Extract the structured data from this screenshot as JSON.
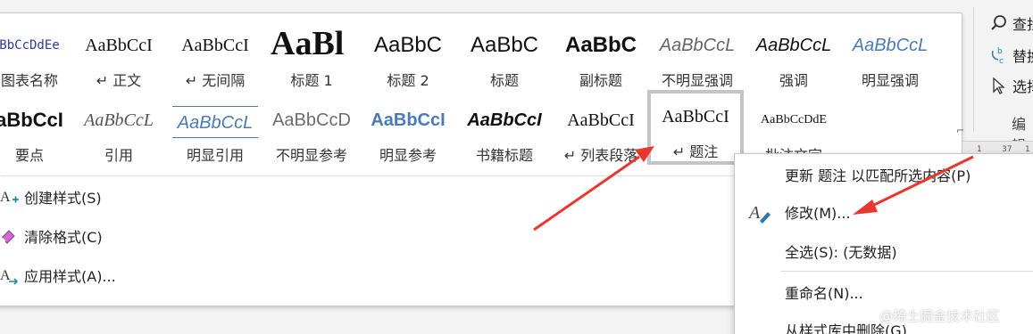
{
  "gallery": {
    "row1": [
      {
        "sample": "BbCcDdEe",
        "label": "图表名称"
      },
      {
        "sample": "AaBbCcI",
        "label": "↵ 正文"
      },
      {
        "sample": "AaBbCcI",
        "label": "↵ 无间隔"
      },
      {
        "sample": "AaBl",
        "label": "标题 1"
      },
      {
        "sample": "AaBbC",
        "label": "标题 2"
      },
      {
        "sample": "AaBbC",
        "label": "标题"
      },
      {
        "sample": "AaBbC",
        "label": "副标题"
      },
      {
        "sample": "AaBbCcL",
        "label": "不明显强调"
      },
      {
        "sample": "AaBbCcL",
        "label": "强调"
      },
      {
        "sample": "AaBbCcL",
        "label": "明显强调"
      }
    ],
    "row2": [
      {
        "sample": "aBbCcI",
        "label": "要点"
      },
      {
        "sample": "AaBbCcL",
        "label": "引用"
      },
      {
        "sample": "AaBbCcL",
        "label": "明显引用"
      },
      {
        "sample": "AaBbCcD",
        "label": "不明显参考"
      },
      {
        "sample": "AaBbCcI",
        "label": "明显参考"
      },
      {
        "sample": "AaBbCcI",
        "label": "书籍标题"
      },
      {
        "sample": "AaBbCcI",
        "label": "↵ 列表段落"
      },
      {
        "sample": "AaBbCcI",
        "label": "↵ 题注"
      },
      {
        "sample": "AaBbCcDdE",
        "label": "批注文字"
      }
    ],
    "commands": [
      {
        "icon": "create-style-icon",
        "label": "创建样式(S)"
      },
      {
        "icon": "clear-format-icon",
        "label": "清除格式(C)"
      },
      {
        "icon": "apply-style-icon",
        "label": "应用样式(A)..."
      }
    ],
    "scroll_glyph": "⌐"
  },
  "ribbon_right": {
    "items": [
      {
        "icon": "search-icon",
        "label": "查找"
      },
      {
        "icon": "replace-icon",
        "label": "替换"
      },
      {
        "icon": "select-cursor-icon",
        "label": "选择"
      }
    ],
    "group_caption": "编辑",
    "ruler_marks": [
      "1",
      "37",
      "1"
    ]
  },
  "context_menu": {
    "items": [
      {
        "icon": "",
        "label": "更新 题注 以匹配所选内容(P)"
      },
      {
        "icon": "modify-pen-icon",
        "label": "修改(M)..."
      },
      {
        "icon": "",
        "label": "全选(S): (无数据)"
      },
      {
        "icon": "",
        "label": "重命名(N)..."
      },
      {
        "icon": "",
        "label": "从样式库中删除(G)"
      }
    ]
  },
  "watermark": "@稀土掘金技术社区",
  "colors": {
    "annotation_arrow": "#e8372f",
    "accent_blue": "#2e75b6",
    "teal": "#1a8fa0"
  }
}
